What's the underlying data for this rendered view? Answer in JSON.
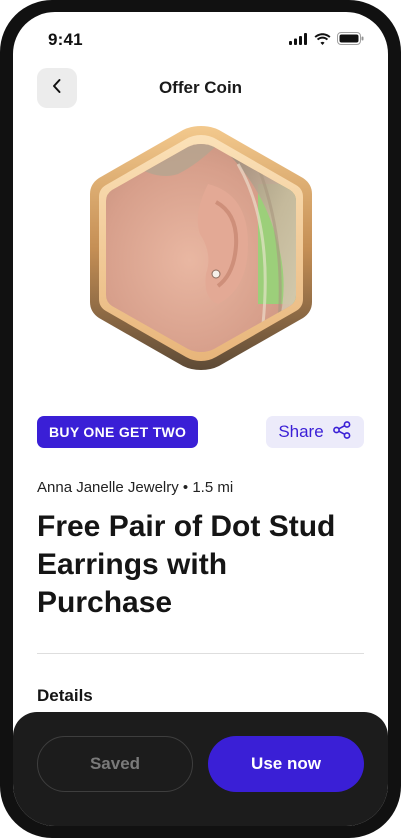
{
  "status_bar": {
    "time": "9:41",
    "icons": [
      "signal-icon",
      "wifi-icon",
      "battery-icon"
    ]
  },
  "header": {
    "title": "Offer Coin",
    "back_icon": "chevron-left-icon"
  },
  "coin": {
    "image_alt": "ear-with-dot-stud-earring"
  },
  "promo": {
    "label": "BUY ONE GET TWO"
  },
  "share": {
    "label": "Share",
    "icon": "share-icon"
  },
  "offer": {
    "merchant": "Anna Janelle Jewelry • 1.5 mi",
    "title": "Free Pair of Dot Stud Earrings with Purchase",
    "details_heading": "Details"
  },
  "actions": {
    "saved_label": "Saved",
    "use_label": "Use now"
  },
  "colors": {
    "accent": "#3a1fd6",
    "accent_light": "#ecebfa",
    "coin_gold": "#d9a86a",
    "bottom_bar": "#1c1c1c"
  }
}
